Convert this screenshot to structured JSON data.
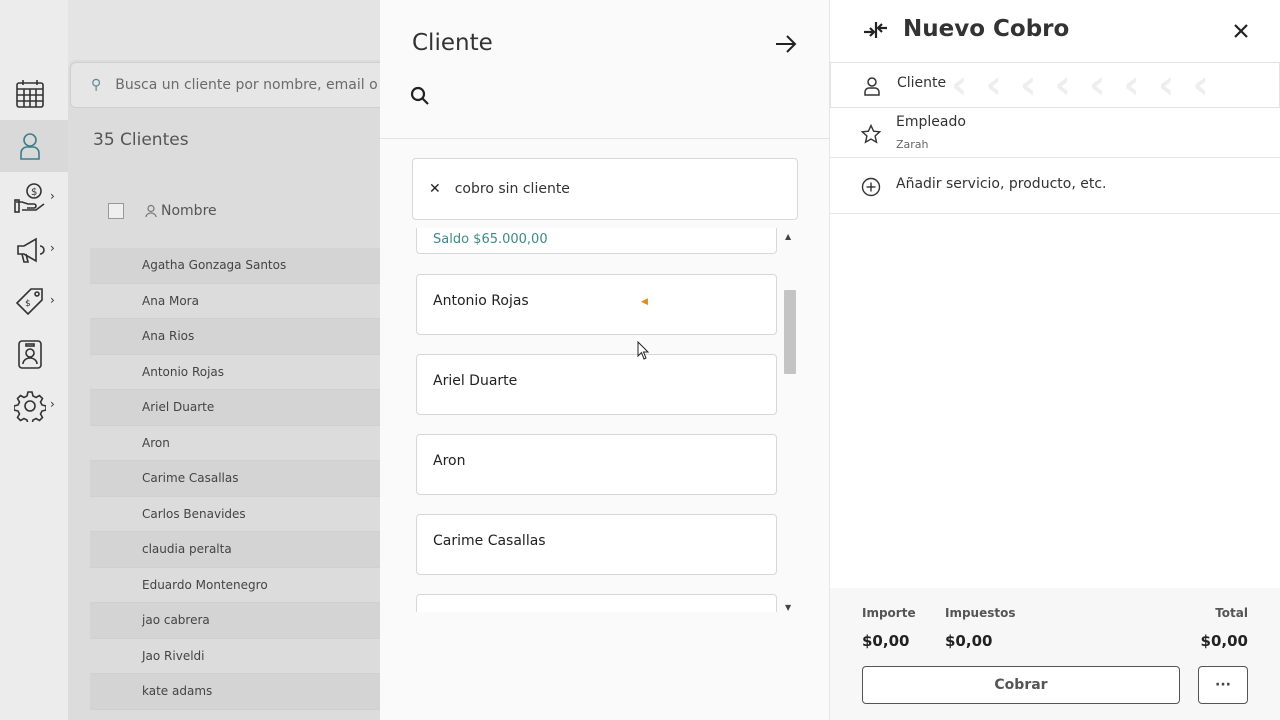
{
  "background_page": {
    "search_placeholder": "Busca un cliente por nombre, email o te",
    "client_count": "35 Clientes",
    "column_name": "Nombre",
    "clients": [
      "Agatha Gonzaga Santos",
      "Ana Mora",
      "Ana Rios",
      "Antonio Rojas",
      "Ariel Duarte",
      "Aron",
      "Carime Casallas",
      "Carlos Benavides",
      "claudia peralta",
      "Eduardo Montenegro",
      "jao cabrera",
      "Jao Riveldi",
      "kate adams"
    ]
  },
  "client_panel": {
    "title": "Cliente",
    "no_client_label": "cobro sin cliente",
    "saldo_text": "Saldo $65.000,00",
    "clients": [
      "Antonio Rojas",
      "Ariel Duarte",
      "Aron",
      "Carime Casallas"
    ]
  },
  "checkout": {
    "title": "Nuevo Cobro",
    "cliente_label": "Cliente",
    "empleado_label": "Empleado",
    "empleado_value": "Zarah",
    "add_item_label": "Añadir servicio, producto, etc.",
    "importe_label": "Importe",
    "importe_value": "$0,00",
    "impuestos_label": "Impuestos",
    "impuestos_value": "$0,00",
    "total_label": "Total",
    "total_value": "$0,00",
    "cobrar_button": "Cobrar",
    "more_button": "···"
  },
  "icons": {
    "nav": [
      "calendar-icon",
      "user-icon",
      "money-hand-icon",
      "megaphone-icon",
      "price-tag-icon",
      "badge-icon",
      "gear-icon"
    ]
  },
  "colors": {
    "accent_teal": "#3e8a8a",
    "search_icon": "#5d8a96",
    "marker_orange": "#e08a20"
  }
}
